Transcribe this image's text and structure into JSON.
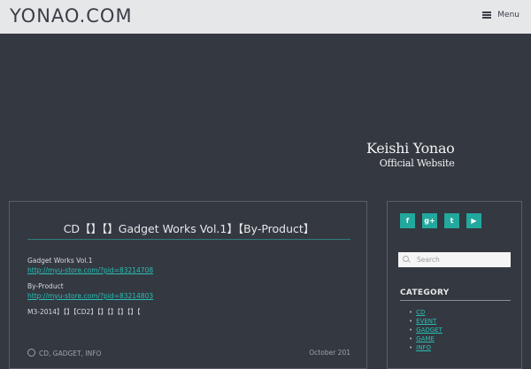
{
  "header": {
    "logo": "YONAO.COM",
    "menu_label": "Menu"
  },
  "hero": {
    "brand_name": "Keishi Yonao",
    "brand_sub": "Official Website"
  },
  "post": {
    "title": "CD【】【】Gadget Works Vol.1】【By-Product】",
    "items": [
      {
        "label": "Gadget Works Vol.1",
        "link": "http://myu-store.com/?pid=83214708"
      },
      {
        "label": "By-Product",
        "link": "http://myu-store.com/?pid=83214803"
      }
    ],
    "note": "M3-2014】【】【CD2】【】【】【】【】【",
    "meta_left": "CD, GADGET, INFO",
    "meta_right": "October 201"
  },
  "sidebar": {
    "social": [
      {
        "name": "facebook",
        "glyph": "f"
      },
      {
        "name": "googleplus",
        "glyph": "g+"
      },
      {
        "name": "twitter",
        "glyph": "t"
      },
      {
        "name": "youtube",
        "glyph": "▶"
      }
    ],
    "search_placeholder": "Search",
    "category_title": "CATEGORY",
    "categories": [
      "CD",
      "EVENT",
      "GADGET",
      "GAME",
      "INFO"
    ]
  },
  "colors": {
    "accent": "#22a89d",
    "link": "#27c0b6",
    "background": "#343841",
    "header": "#e6e7e9"
  }
}
